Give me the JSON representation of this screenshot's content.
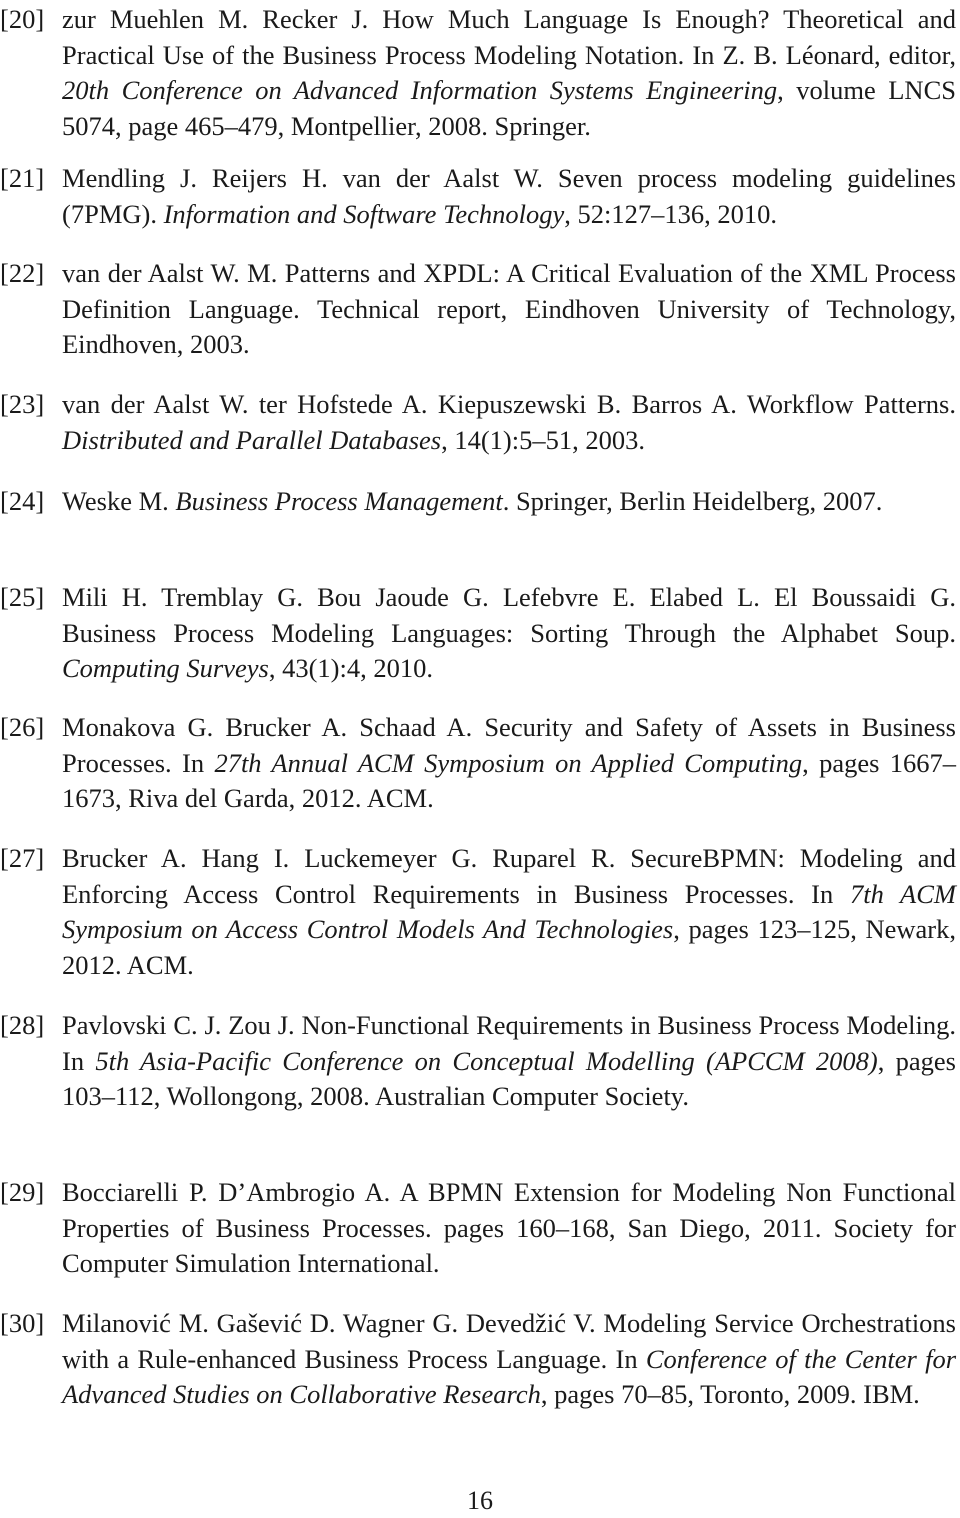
{
  "references": [
    {
      "label": "[20]",
      "parts": [
        {
          "t": "zur Muehlen M. Recker J. How Much Language Is Enough? Theoretical and Practical Use of the Business Process Modeling Notation. In Z. B. Léonard, editor, ",
          "i": false
        },
        {
          "t": "20th Conference on Advanced Information Systems Engineering",
          "i": true
        },
        {
          "t": ", volume LNCS 5074, page 465–479, Montpellier, 2008. Springer.",
          "i": false
        }
      ]
    },
    {
      "label": "[21]",
      "parts": [
        {
          "t": "Mendling J. Reijers H. van der Aalst W. Seven process modeling guidelines (7PMG). ",
          "i": false
        },
        {
          "t": "Information and Software Technology",
          "i": true
        },
        {
          "t": ", 52:127–136, 2010.",
          "i": false
        }
      ]
    },
    {
      "label": "[22]",
      "parts": [
        {
          "t": "van der Aalst W. M. Patterns and XPDL: A Critical Evaluation of the XML Process Definition Language.  Technical report, Eindhoven University of Technology, Eindhoven, 2003.",
          "i": false
        }
      ]
    },
    {
      "label": "[23]",
      "parts": [
        {
          "t": "van der Aalst W. ter Hofstede A. Kiepuszewski B. Barros A.  Workflow Patterns. ",
          "i": false
        },
        {
          "t": "Distributed and Parallel Databases",
          "i": true
        },
        {
          "t": ", 14(1):5–51, 2003.",
          "i": false
        }
      ]
    },
    {
      "label": "[24]",
      "parts": [
        {
          "t": "Weske M.  ",
          "i": false
        },
        {
          "t": "Business Process Management",
          "i": true
        },
        {
          "t": ".  Springer, Berlin Heidelberg, 2007.",
          "i": false
        }
      ]
    },
    {
      "label": "[25]",
      "parts": [
        {
          "t": "Mili H. Tremblay G. Bou Jaoude G. Lefebvre E. Elabed L. El Boussaidi G. Business Process Modeling Languages: Sorting Through the Alphabet Soup. ",
          "i": false
        },
        {
          "t": "Computing Surveys",
          "i": true
        },
        {
          "t": ", 43(1):4, 2010.",
          "i": false
        }
      ]
    },
    {
      "label": "[26]",
      "parts": [
        {
          "t": "Monakova G. Brucker A. Schaad A.  Security and Safety of Assets in Business Processes.  In ",
          "i": false
        },
        {
          "t": "27th Annual ACM Symposium on Applied Computing",
          "i": true
        },
        {
          "t": ", pages 1667–1673, Riva del Garda, 2012. ACM.",
          "i": false
        }
      ]
    },
    {
      "label": "[27]",
      "parts": [
        {
          "t": "Brucker A. Hang I. Luckemeyer G. Ruparel R. SecureBPMN: Modeling and Enforcing Access Control Requirements in Business Processes. In ",
          "i": false
        },
        {
          "t": "7th ACM Symposium on Access Control Models And Technologies",
          "i": true
        },
        {
          "t": ", pages 123–125, Newark, 2012. ACM.",
          "i": false
        }
      ]
    },
    {
      "label": "[28]",
      "parts": [
        {
          "t": "Pavlovski C. J. Zou J.  Non-Functional Requirements in Business Process Modeling.  In ",
          "i": false
        },
        {
          "t": "5th Asia-Pacific Conference on Conceptual Modelling (APCCM 2008)",
          "i": true
        },
        {
          "t": ", pages 103–112, Wollongong, 2008. Australian Computer Society.",
          "i": false
        }
      ]
    },
    {
      "label": "[29]",
      "parts": [
        {
          "t": "Bocciarelli P. D’Ambrogio A.  A BPMN Extension for Modeling Non Functional Properties of Business Processes.  pages 160–168, San Diego, 2011. Society for Computer Simulation International.",
          "i": false
        }
      ]
    },
    {
      "label": "[30]",
      "parts": [
        {
          "t": "Milanović M. Gašević D. Wagner G. Devedžić V.  Modeling Service Orchestrations with a Rule-enhanced Business Process Language.  In ",
          "i": false
        },
        {
          "t": "Conference of the Center for Advanced Studies on Collaborative Research",
          "i": true
        },
        {
          "t": ", pages 70–85, Toronto, 2009. IBM.",
          "i": false
        }
      ]
    }
  ],
  "page_number": "16"
}
